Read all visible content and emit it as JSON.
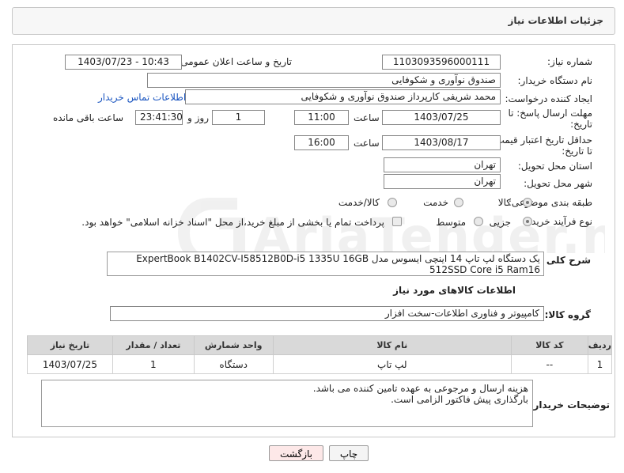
{
  "header": {
    "title": "جزئیات اطلاعات نیاز"
  },
  "form": {
    "need_number_label": "شماره نیاز:",
    "need_number": "1103093596000111",
    "announce_label": "تاریخ و ساعت اعلان عمومی:",
    "announce_value": "1403/07/23 - 10:43",
    "buyer_org_label": "نام دستگاه خریدار:",
    "buyer_org": "صندوق نوآوری و شکوفایی",
    "creator_label": "ایجاد کننده درخواست:",
    "creator": "محمد  شریفی کارپرداز صندوق نوآوری و شکوفایی",
    "contact_link": "اطلاعات تماس خریدار",
    "reply_deadline_label": "مهلت ارسال پاسخ: تا تاریخ:",
    "reply_date": "1403/07/25",
    "time_label": "ساعت",
    "reply_time": "11:00",
    "days_value": "1",
    "days_label": "روز و",
    "remaining_time": "23:41:30",
    "remaining_label": "ساعت باقی مانده",
    "price_validity_label": "حداقل تاریخ اعتبار قیمت: تا تاریخ:",
    "price_date": "1403/08/17",
    "price_time": "16:00",
    "province_label": "استان محل تحویل:",
    "province": "تهران",
    "city_label": "شهر محل تحویل:",
    "city": "تهران",
    "category_label": "طبقه بندی موضوعی:",
    "category_options": [
      "کالا",
      "خدمت",
      "کالا/خدمت"
    ],
    "process_label": "نوع فرآیند خرید :",
    "process_options": [
      "جزیی",
      "متوسط"
    ],
    "payment_note": "پرداخت تمام یا بخشی از مبلغ خرید،از محل \"اسناد خزانه اسلامی\" خواهد بود."
  },
  "description": {
    "label": "شرح کلی نیاز:",
    "text": "یک دستگاه لپ تاپ 14 اینچی ایسوس مدل ExpertBook B1402CV-I58512B0D-i5 1335U 16GB 512SSD Core i5 Ram16"
  },
  "goods_info": {
    "title": "اطلاعات کالاهای مورد نیاز",
    "group_label": "گروه کالا:",
    "group_value": "کامپیوتر و فناوری اطلاعات-سخت افزار"
  },
  "table": {
    "headers": [
      "ردیف",
      "کد کالا",
      "نام کالا",
      "واحد شمارش",
      "تعداد / مقدار",
      "تاریخ نیاز"
    ],
    "rows": [
      [
        "1",
        "--",
        "لپ تاپ",
        "دستگاه",
        "1",
        "1403/07/25"
      ]
    ]
  },
  "buyer_notes": {
    "label": "توضیحات خریدار:",
    "line1": "هزینه ارسال و مرجوعی به عهده تامین کننده می باشد.",
    "line2": "بارگذاری پیش فاکتور الزامی است."
  },
  "buttons": {
    "print": "چاپ",
    "back": "بازگشت"
  },
  "watermark": {
    "text": "AriaTender.neT"
  },
  "colors": {
    "link": "#1a55c0",
    "back_button_bg": "#fde8e8",
    "header_bg": "#f7f7f7",
    "table_header_bg": "#d9d9d9"
  }
}
